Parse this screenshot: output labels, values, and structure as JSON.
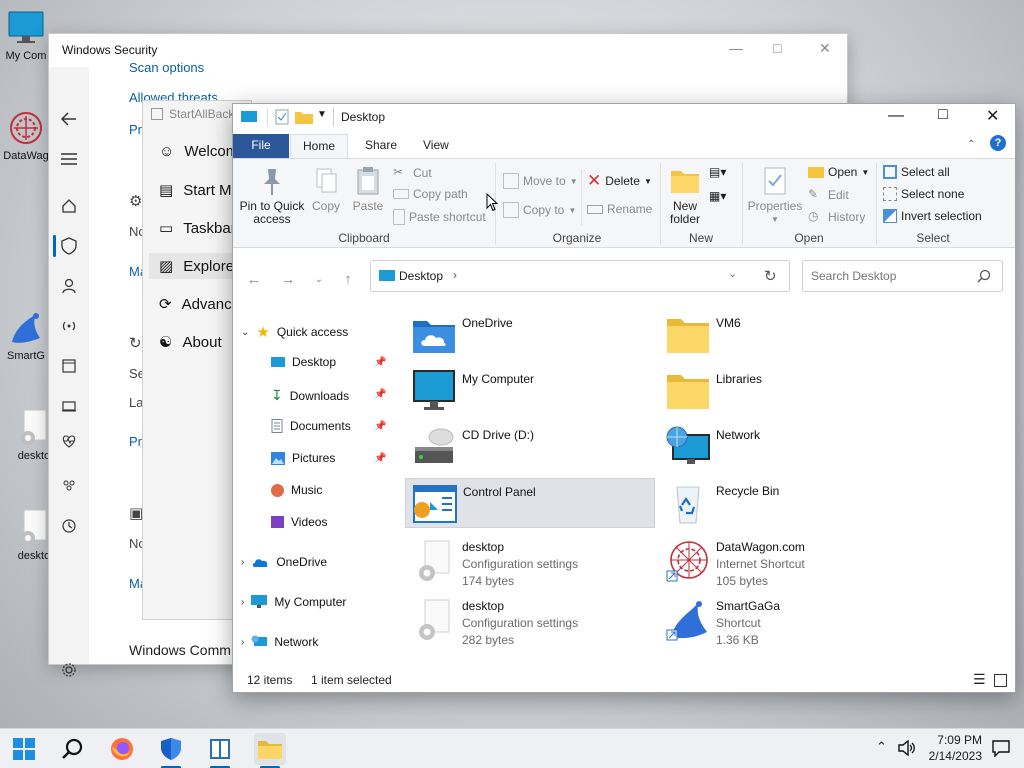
{
  "desktop": {
    "icons": [
      {
        "label": "My Com"
      },
      {
        "label": "DataWag"
      },
      {
        "label": "SmartG"
      },
      {
        "label": "deskto"
      },
      {
        "label": "deskto"
      }
    ]
  },
  "security": {
    "title": "Windows Security",
    "links": [
      "Scan options",
      "Allowed threats",
      "Pr",
      "Ma",
      "Pr",
      "Ma"
    ],
    "texts": [
      "No",
      "Se",
      "La",
      "No"
    ],
    "bottom_text": "Windows Comm"
  },
  "startallback": {
    "title": "StartAllBack",
    "items": [
      "Welcom",
      "Start M",
      "Taskbar",
      "Explore",
      "Advanc",
      "About"
    ]
  },
  "explorer": {
    "title": "Desktop",
    "tabs": [
      "File",
      "Home",
      "Share",
      "View"
    ],
    "ribbon": {
      "pin": "Pin to Quick access",
      "copy": "Copy",
      "paste": "Paste",
      "cut": "Cut",
      "copy_path": "Copy path",
      "paste_shortcut": "Paste shortcut",
      "clipboard": "Clipboard",
      "move_to": "Move to",
      "copy_to": "Copy to",
      "delete": "Delete",
      "rename": "Rename",
      "organize": "Organize",
      "new_folder": "New folder",
      "new": "New",
      "properties": "Properties",
      "open": "Open",
      "edit": "Edit",
      "history": "History",
      "open_group": "Open",
      "select_all": "Select all",
      "select_none": "Select none",
      "invert_selection": "Invert selection",
      "select_group": "Select"
    },
    "address": "Desktop",
    "search_placeholder": "Search Desktop",
    "nav": {
      "quick_access": "Quick access",
      "pinned": [
        "Desktop",
        "Downloads",
        "Documents",
        "Pictures"
      ],
      "unpinned": [
        "Music",
        "Videos"
      ],
      "roots": [
        "OneDrive",
        "My Computer",
        "Network"
      ]
    },
    "items": [
      {
        "name": "OneDrive",
        "icon": "onedrive-icon"
      },
      {
        "name": "VM6",
        "icon": "folder-icon"
      },
      {
        "name": "My Computer",
        "icon": "monitor-icon"
      },
      {
        "name": "Libraries",
        "icon": "folder-icon"
      },
      {
        "name": "CD Drive (D:)",
        "icon": "cd-drive-icon"
      },
      {
        "name": "Network",
        "icon": "network-icon"
      },
      {
        "name": "Control Panel",
        "icon": "control-panel-icon"
      },
      {
        "name": "Recycle Bin",
        "icon": "recycle-bin-icon"
      },
      {
        "name": "desktop",
        "type": "Configuration settings",
        "size": "174 bytes",
        "icon": "settings-file-icon"
      },
      {
        "name": "DataWagon.com",
        "type": "Internet Shortcut",
        "size": "105 bytes",
        "icon": "datawagon-icon"
      },
      {
        "name": "desktop",
        "type": "Configuration settings",
        "size": "282 bytes",
        "icon": "settings-file-icon"
      },
      {
        "name": "SmartGaGa",
        "type": "Shortcut",
        "size": "1.36 KB",
        "icon": "smartgaga-icon"
      }
    ],
    "status": {
      "count": "12 items",
      "selected": "1 item selected"
    }
  },
  "taskbar": {
    "time": "7:09 PM",
    "date": "2/14/2023"
  },
  "colors": {
    "accent": "#0067c0",
    "file_tab": "#2b579a",
    "folder": "#f5c542",
    "selection": "#dfe3e8"
  }
}
